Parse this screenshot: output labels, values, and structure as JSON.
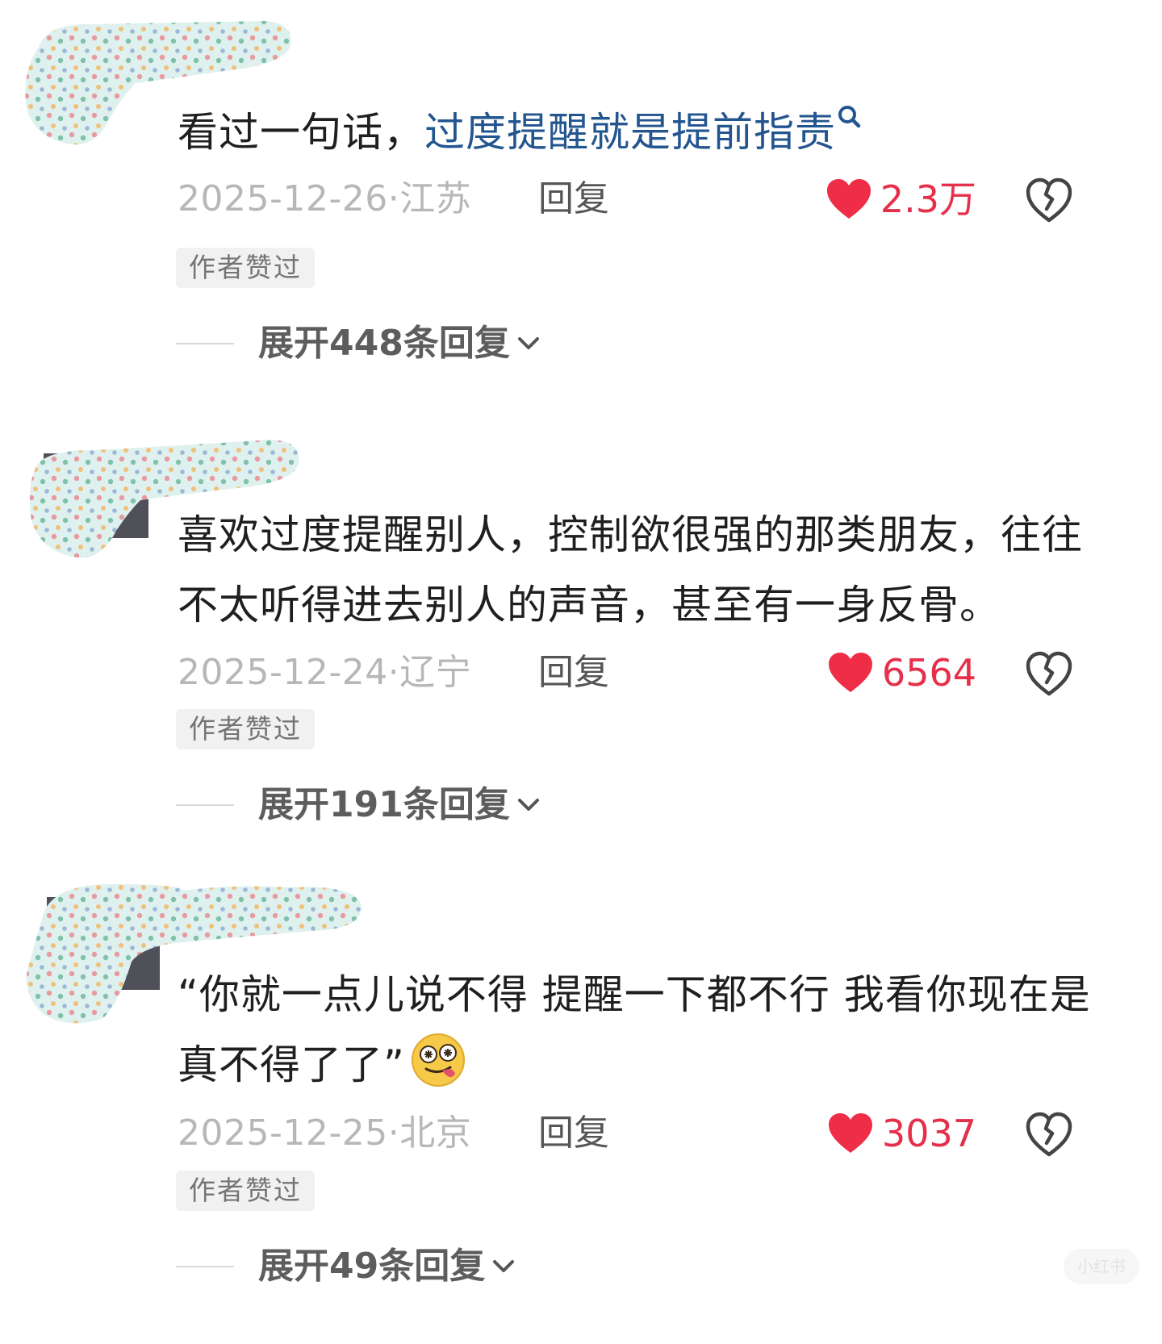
{
  "colors": {
    "body_text": "#1f1f1f",
    "link": "#23558f",
    "meta": "#b7b7b7",
    "reply": "#555555",
    "like": "#e6304b",
    "badge_bg": "#f1f1f1",
    "badge_text": "#747474",
    "expand_text": "#5d5d5d"
  },
  "comments": [
    {
      "text_plain": "看过一句话，",
      "text_link": "过度提醒就是提前指责",
      "link_icon": "search-icon",
      "date_location": "2025-12-26·江苏",
      "reply_label": "回复",
      "like_count": "2.3万",
      "author_badge": "作者赞过",
      "expand_label": "展开448条回复"
    },
    {
      "text_plain": "喜欢过度提醒别人，控制欲很强的那类朋友，往往不太听得进去别人的声音，甚至有一身反骨。",
      "date_location": "2025-12-24·辽宁",
      "reply_label": "回复",
      "like_count": "6564",
      "author_badge": "作者赞过",
      "expand_label": "展开191条回复"
    },
    {
      "text_plain": "“你就一点儿说不得 提醒一下都不行 我看你现在是真不得了了”",
      "emoji": "dizzy-tongue-face-emoji",
      "date_location": "2025-12-25·北京",
      "reply_label": "回复",
      "like_count": "3037",
      "author_badge": "作者赞过",
      "expand_label": "展开49条回复"
    }
  ],
  "watermark": "小红书"
}
